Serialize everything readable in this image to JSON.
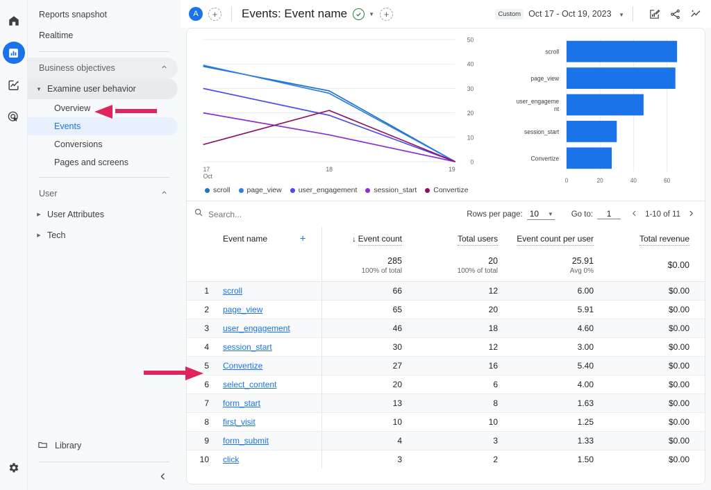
{
  "rail": {
    "items": [
      {
        "name": "home-icon",
        "label": "Home"
      },
      {
        "name": "reports-icon",
        "label": "Reports"
      },
      {
        "name": "explore-icon",
        "label": "Explore"
      },
      {
        "name": "advertising-icon",
        "label": "Advertising"
      }
    ],
    "settings_label": "Admin"
  },
  "sidebar": {
    "top_items": [
      {
        "label": "Reports snapshot"
      },
      {
        "label": "Realtime"
      }
    ],
    "sections": [
      {
        "label": "Business objectives",
        "group": {
          "label": "Examine user behavior"
        },
        "children": [
          {
            "label": "Overview",
            "selected": false
          },
          {
            "label": "Events",
            "selected": true
          },
          {
            "label": "Conversions",
            "selected": false
          },
          {
            "label": "Pages and screens",
            "selected": false
          }
        ]
      },
      {
        "label": "User",
        "collapsed_items": [
          {
            "label": "User Attributes"
          },
          {
            "label": "Tech"
          }
        ]
      }
    ],
    "library_label": "Library",
    "collapse_label": "Collapse navigation"
  },
  "topbar": {
    "account_initial": "A",
    "add_comparison_label": "+",
    "title": "Events: Event name",
    "add_label": "+",
    "date_chip": "Custom",
    "date_range": "Oct 17 - Oct 19, 2023",
    "icons": [
      {
        "name": "edit-report-icon"
      },
      {
        "name": "share-icon"
      },
      {
        "name": "insights-icon"
      }
    ]
  },
  "chart_data": [
    {
      "type": "line",
      "title": "",
      "xlabel": "Oct",
      "ylabel": "",
      "x": [
        "17",
        "18",
        "19"
      ],
      "x_sublabel": "Oct",
      "ylim": [
        0,
        50
      ],
      "yticks": [
        0,
        10,
        20,
        30,
        40,
        50
      ],
      "grid": true,
      "legend_position": "bottom",
      "series": [
        {
          "name": "scroll",
          "color": "#1a73c8",
          "values": [
            39,
            29,
            0
          ]
        },
        {
          "name": "page_view",
          "color": "#2f7de1",
          "values": [
            39.5,
            28,
            0
          ]
        },
        {
          "name": "user_engagement",
          "color": "#4e49e8",
          "values": [
            30,
            19,
            0
          ]
        },
        {
          "name": "session_start",
          "color": "#8b2fd1",
          "values": [
            20,
            11,
            0
          ]
        },
        {
          "name": "Convertize",
          "color": "#8e1066",
          "values": [
            7,
            21,
            0
          ]
        }
      ]
    },
    {
      "type": "bar",
      "orientation": "horizontal",
      "title": "",
      "xlabel": "",
      "ylabel": "",
      "categories": [
        "scroll",
        "page_view",
        "user_engagement",
        "session_start",
        "Convertize"
      ],
      "values": [
        66,
        65,
        46,
        30,
        27
      ],
      "color": "#1a73e8",
      "xlim": [
        0,
        70
      ],
      "xticks": [
        0,
        20,
        40,
        60
      ],
      "grid": true
    }
  ],
  "table_controls": {
    "search_placeholder": "Search...",
    "rows_per_page_label": "Rows per page:",
    "rows_per_page_value": "10",
    "goto_label": "Go to:",
    "goto_value": "1",
    "range_text": "1-10 of 11"
  },
  "table": {
    "columns": [
      {
        "key": "rank",
        "label": "",
        "align": "right"
      },
      {
        "key": "name",
        "label": "Event name",
        "align": "left"
      },
      {
        "key": "count",
        "label": "Event count",
        "align": "right",
        "sorted": true,
        "sort_dir": "desc"
      },
      {
        "key": "users",
        "label": "Total users",
        "align": "right"
      },
      {
        "key": "per_user",
        "label": "Event count per user",
        "align": "right"
      },
      {
        "key": "revenue",
        "label": "Total revenue",
        "align": "right"
      }
    ],
    "summary": {
      "count": "285",
      "count_sub": "100% of total",
      "users": "20",
      "users_sub": "100% of total",
      "per_user": "25.91",
      "per_user_sub": "Avg 0%",
      "revenue": "$0.00",
      "revenue_sub": ""
    },
    "rows": [
      {
        "rank": "1",
        "name": "scroll",
        "count": "66",
        "users": "12",
        "per_user": "6.00",
        "revenue": "$0.00"
      },
      {
        "rank": "2",
        "name": "page_view",
        "count": "65",
        "users": "20",
        "per_user": "5.91",
        "revenue": "$0.00"
      },
      {
        "rank": "3",
        "name": "user_engagement",
        "count": "46",
        "users": "18",
        "per_user": "4.60",
        "revenue": "$0.00"
      },
      {
        "rank": "4",
        "name": "session_start",
        "count": "30",
        "users": "12",
        "per_user": "3.00",
        "revenue": "$0.00"
      },
      {
        "rank": "5",
        "name": "Convertize",
        "count": "27",
        "users": "16",
        "per_user": "5.40",
        "revenue": "$0.00"
      },
      {
        "rank": "6",
        "name": "select_content",
        "count": "20",
        "users": "6",
        "per_user": "4.00",
        "revenue": "$0.00"
      },
      {
        "rank": "7",
        "name": "form_start",
        "count": "13",
        "users": "8",
        "per_user": "1.63",
        "revenue": "$0.00"
      },
      {
        "rank": "8",
        "name": "first_visit",
        "count": "10",
        "users": "10",
        "per_user": "1.25",
        "revenue": "$0.00"
      },
      {
        "rank": "9",
        "name": "form_submit",
        "count": "4",
        "users": "3",
        "per_user": "1.33",
        "revenue": "$0.00"
      },
      {
        "rank": "10",
        "name": "click",
        "count": "3",
        "users": "2",
        "per_user": "1.50",
        "revenue": "$0.00"
      }
    ]
  },
  "annotations": {
    "color": "#e0245e",
    "arrows": [
      {
        "name": "arrow-pointing-events-nav",
        "direction": "left"
      },
      {
        "name": "arrow-pointing-convertize-row",
        "direction": "right"
      }
    ]
  }
}
